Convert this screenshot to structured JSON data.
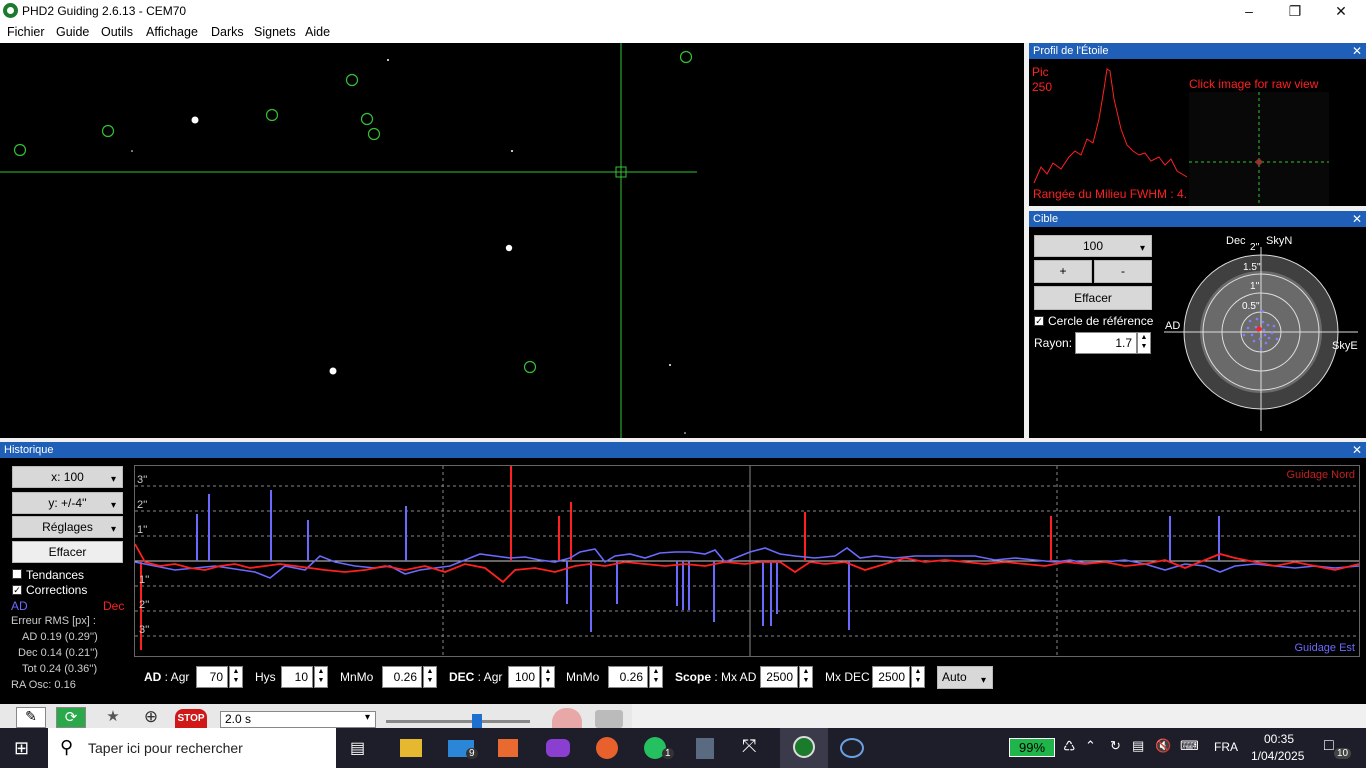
{
  "window": {
    "title": "PHD2 Guiding 2.6.13 - CEM70"
  },
  "menu": [
    "Fichier",
    "Guide",
    "Outils",
    "Affichage",
    "Darks",
    "Signets",
    "Aide"
  ],
  "profile_panel": {
    "title": "Profil de l'Étoile",
    "peak_label": "Pic",
    "peak_value": "250",
    "raw_hint": "Click image for raw view",
    "fwhm_text": "Rangée du Milieu FWHM : 4."
  },
  "target_panel": {
    "title": "Cible",
    "zoom_value": "100",
    "plus": "+",
    "minus": "-",
    "clear": "Effacer",
    "ref_circle_label": "Cercle de référence",
    "radius_label": "Rayon:",
    "radius_value": "1.7",
    "labels": {
      "dec": "Dec",
      "skyn": "SkyN",
      "ad": "AD",
      "skye": "SkyE"
    },
    "rings": [
      "2''",
      "1.5''",
      "1''",
      "0.5''"
    ]
  },
  "history": {
    "title": "Historique",
    "x_btn": "x: 100",
    "y_btn": "y: +/-4''",
    "settings_btn": "Réglages",
    "clear_btn": "Effacer",
    "trends_label": "Tendances",
    "corrections_label": "Corrections",
    "ad_label": "AD",
    "dec_label": "Dec",
    "rms_title": "Erreur RMS [px] :",
    "rms_ad": "AD  0.19 (0.29'')",
    "rms_dec": "Dec  0.14 (0.21'')",
    "rms_tot": "Tot  0.24 (0.36'')",
    "ra_osc": "RA Osc: 0.16",
    "y_ticks": [
      "3''",
      "2''",
      "1''",
      "1''",
      "2''",
      "3''"
    ],
    "north_label": "Guidage Nord",
    "east_label": "Guidage Est",
    "controls": {
      "ad_label": "AD : Agr",
      "ad_agr": "70",
      "hys_label": "Hys",
      "hys": "10",
      "mnmo_label": "MnMo",
      "ad_mnmo": "0.26",
      "dec_label": "DEC : Agr",
      "dec_agr": "100",
      "dec_mnmo_label": "MnMo",
      "dec_mnmo": "0.26",
      "scope_label": "Scope : Mx AD",
      "mx_ad": "2500",
      "mx_dec_label": "Mx DEC",
      "mx_dec": "2500",
      "mode": "Auto"
    }
  },
  "toolbar": {
    "exposure": "2.0 s"
  },
  "taskbar": {
    "search_placeholder": "Taper ici pour rechercher",
    "battery": "99%",
    "lang": "FRA",
    "time": "00:35",
    "date": "1/04/2025",
    "mail_badge": "9",
    "whatsapp_badge": "1",
    "notif_badge": "10"
  },
  "colors": {
    "accent": "#1f5fb8",
    "star_ring": "#34c234",
    "ra_line": "#6a6aff",
    "dec_line": "#ff2020"
  }
}
